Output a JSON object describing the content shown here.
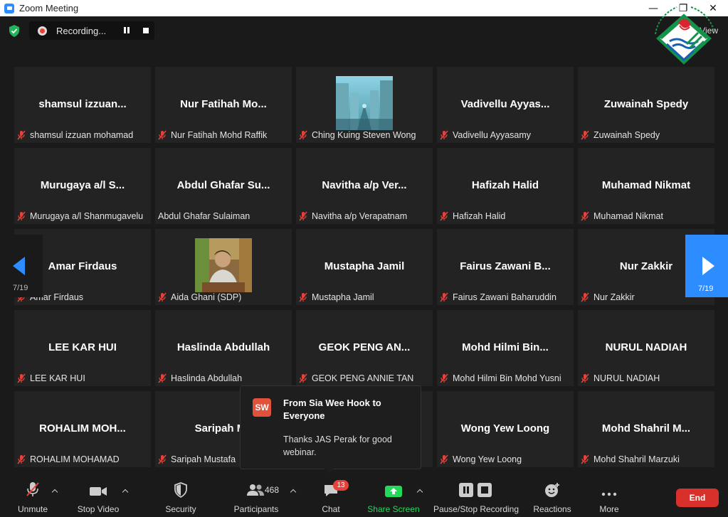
{
  "window": {
    "title": "Zoom Meeting",
    "minimize": "—",
    "restore": "❐",
    "close": "✕"
  },
  "recording": {
    "label": "Recording..."
  },
  "view": {
    "label": "View"
  },
  "pagination": {
    "left": "7/19",
    "right": "7/19"
  },
  "tiles": [
    {
      "display": "shamsul  izzuan...",
      "label": "shamsul izzuan mohamad",
      "muted": true,
      "video": false
    },
    {
      "display": "Nur Fatihah Mo...",
      "label": "Nur Fatihah Mohd Raffik",
      "muted": true,
      "video": false
    },
    {
      "display": "",
      "label": "Ching Kuing Steven Wong",
      "muted": true,
      "video": "street"
    },
    {
      "display": "Vadivellu  Ayyas...",
      "label": "Vadivellu Ayyasamy",
      "muted": true,
      "video": false
    },
    {
      "display": "Zuwainah Spedy",
      "label": "Zuwainah Spedy",
      "muted": true,
      "video": false
    },
    {
      "display": "Murugaya  a/l  S...",
      "label": "Murugaya a/l Shanmugavelu",
      "muted": true,
      "video": false
    },
    {
      "display": "Abdul  Ghafar  Su...",
      "label": "Abdul Ghafar Sulaiman",
      "muted": false,
      "video": false
    },
    {
      "display": "Navitha  a/p  Ver...",
      "label": "Navitha a/p Verapatnam",
      "muted": true,
      "video": false
    },
    {
      "display": "Hafizah Halid",
      "label": "Hafizah Halid",
      "muted": true,
      "video": false
    },
    {
      "display": "Muhamad Nikmat",
      "label": "Muhamad Nikmat",
      "muted": true,
      "video": false
    },
    {
      "display": "Amar Firdaus",
      "label": "Amar Firdaus",
      "muted": true,
      "video": false
    },
    {
      "display": "",
      "label": "Aida Ghani (SDP)",
      "muted": true,
      "video": "person"
    },
    {
      "display": "Mustapha Jamil",
      "label": "Mustapha Jamil",
      "muted": true,
      "video": false
    },
    {
      "display": "Fairus  Zawani  B...",
      "label": "Fairus Zawani Baharuddin",
      "muted": true,
      "video": false
    },
    {
      "display": "Nur Zakkir",
      "label": "Nur Zakkir",
      "muted": true,
      "video": false
    },
    {
      "display": "LEE KAR HUI",
      "label": "LEE KAR HUI",
      "muted": true,
      "video": false
    },
    {
      "display": "Haslinda Abdullah",
      "label": "Haslinda Abdullah",
      "muted": true,
      "video": false
    },
    {
      "display": "GEOK PENG AN...",
      "label": "GEOK PENG ANNIE TAN",
      "muted": true,
      "video": false
    },
    {
      "display": "Mohd  Hilmi  Bin...",
      "label": "Mohd Hilmi Bin Mohd Yusni",
      "muted": true,
      "video": false
    },
    {
      "display": "NURUL NADIAH",
      "label": "NURUL NADIAH",
      "muted": true,
      "video": false
    },
    {
      "display": "ROHALIM  MOH...",
      "label": "ROHALIM MOHAMAD",
      "muted": true,
      "video": false
    },
    {
      "display": "Saripah Mu",
      "label": "Saripah Mustafa",
      "muted": true,
      "video": false
    },
    {
      "display": "",
      "label": "",
      "muted": false,
      "video": false
    },
    {
      "display": "Wong Yew Loong",
      "label": "Wong Yew Loong",
      "muted": true,
      "video": false
    },
    {
      "display": "Mohd  Shahril  M...",
      "label": "Mohd Shahril Marzuki",
      "muted": true,
      "video": false
    }
  ],
  "chat_toast": {
    "avatar": "SW",
    "from": "From Sia Wee Hook to Everyone",
    "message": "Thanks JAS Perak for good webinar."
  },
  "toolbar": {
    "unmute": "Unmute",
    "stop_video": "Stop Video",
    "security": "Security",
    "participants": "Participants",
    "participant_count": "468",
    "chat": "Chat",
    "chat_badge": "13",
    "share_screen": "Share Screen",
    "pause_stop_recording": "Pause/Stop Recording",
    "reactions": "Reactions",
    "more": "More",
    "end": "End"
  },
  "colors": {
    "accent": "#2d8cff",
    "share": "#23d959",
    "end": "#d8302b",
    "mute": "#e8413a"
  }
}
